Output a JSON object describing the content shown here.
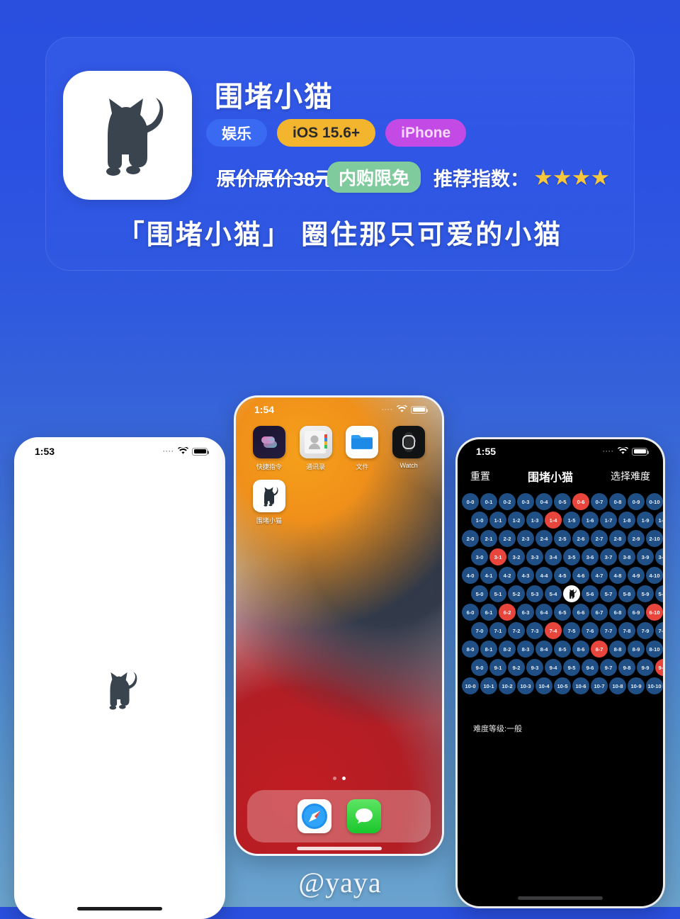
{
  "background": {
    "top_color": "#2a4fdf",
    "bottom_color": "#6aa3cd"
  },
  "promo": {
    "app_name": "围堵小猫",
    "app_icon": "cat-silhouette-icon",
    "tags": [
      {
        "label": "娱乐",
        "color": "#3a69f2",
        "text_color": "#ffffff"
      },
      {
        "label": "iOS 15.6+",
        "color": "#f4b52e",
        "text_color": "#2a2a2a"
      },
      {
        "label": "iPhone",
        "color": "#c44ae6",
        "text_color": "#f6d9fb"
      }
    ],
    "price_original": "原价原价38元",
    "free_badge": "内购限免",
    "free_badge_color": "#7fcb9e",
    "rating_label": "推荐指数：",
    "stars": "★★★★",
    "star_color": "#f6c63c",
    "star_count": 4,
    "tagline": "「围堵小猫」 圈住那只可爱的小猫"
  },
  "phone_splash": {
    "status": {
      "time": "1:53",
      "signal": "····",
      "wifi": "wifi-icon",
      "battery": "battery-icon"
    },
    "content_icon": "cat-silhouette-icon"
  },
  "phone_home": {
    "status": {
      "time": "1:54",
      "signal": "····",
      "wifi": "wifi-icon",
      "battery": "battery-icon"
    },
    "apps": [
      {
        "label": "快捷指令",
        "icon": "shortcuts-icon"
      },
      {
        "label": "通讯录",
        "icon": "contacts-icon"
      },
      {
        "label": "文件",
        "icon": "files-icon"
      },
      {
        "label": "Watch",
        "icon": "watch-icon"
      },
      {
        "label": "围堵小猫",
        "icon": "cat-silhouette-icon"
      }
    ],
    "page_dots": {
      "count": 2,
      "active_index": 1
    },
    "dock": [
      {
        "label": "Safari",
        "icon": "safari-icon"
      },
      {
        "label": "信息",
        "icon": "messages-icon"
      }
    ]
  },
  "phone_game": {
    "status": {
      "time": "1:55",
      "signal": "····",
      "wifi": "wifi-icon",
      "battery": "battery-icon"
    },
    "nav": {
      "reset": "重置",
      "title": "围堵小猫",
      "difficulty_select": "选择难度"
    },
    "difficulty_text": "难度等级:一般",
    "board": {
      "rows": 11,
      "cols": 11,
      "cell_color": "#1f4f85",
      "blocked_color": "#e8453c",
      "cat_position": {
        "row": 5,
        "col": 5
      },
      "blocked": [
        {
          "row": 0,
          "col": 6
        },
        {
          "row": 1,
          "col": 4
        },
        {
          "row": 3,
          "col": 1
        },
        {
          "row": 6,
          "col": 2
        },
        {
          "row": 6,
          "col": 10
        },
        {
          "row": 7,
          "col": 4
        },
        {
          "row": 8,
          "col": 7
        },
        {
          "row": 9,
          "col": 10
        }
      ]
    }
  },
  "watermark": "@yaya"
}
